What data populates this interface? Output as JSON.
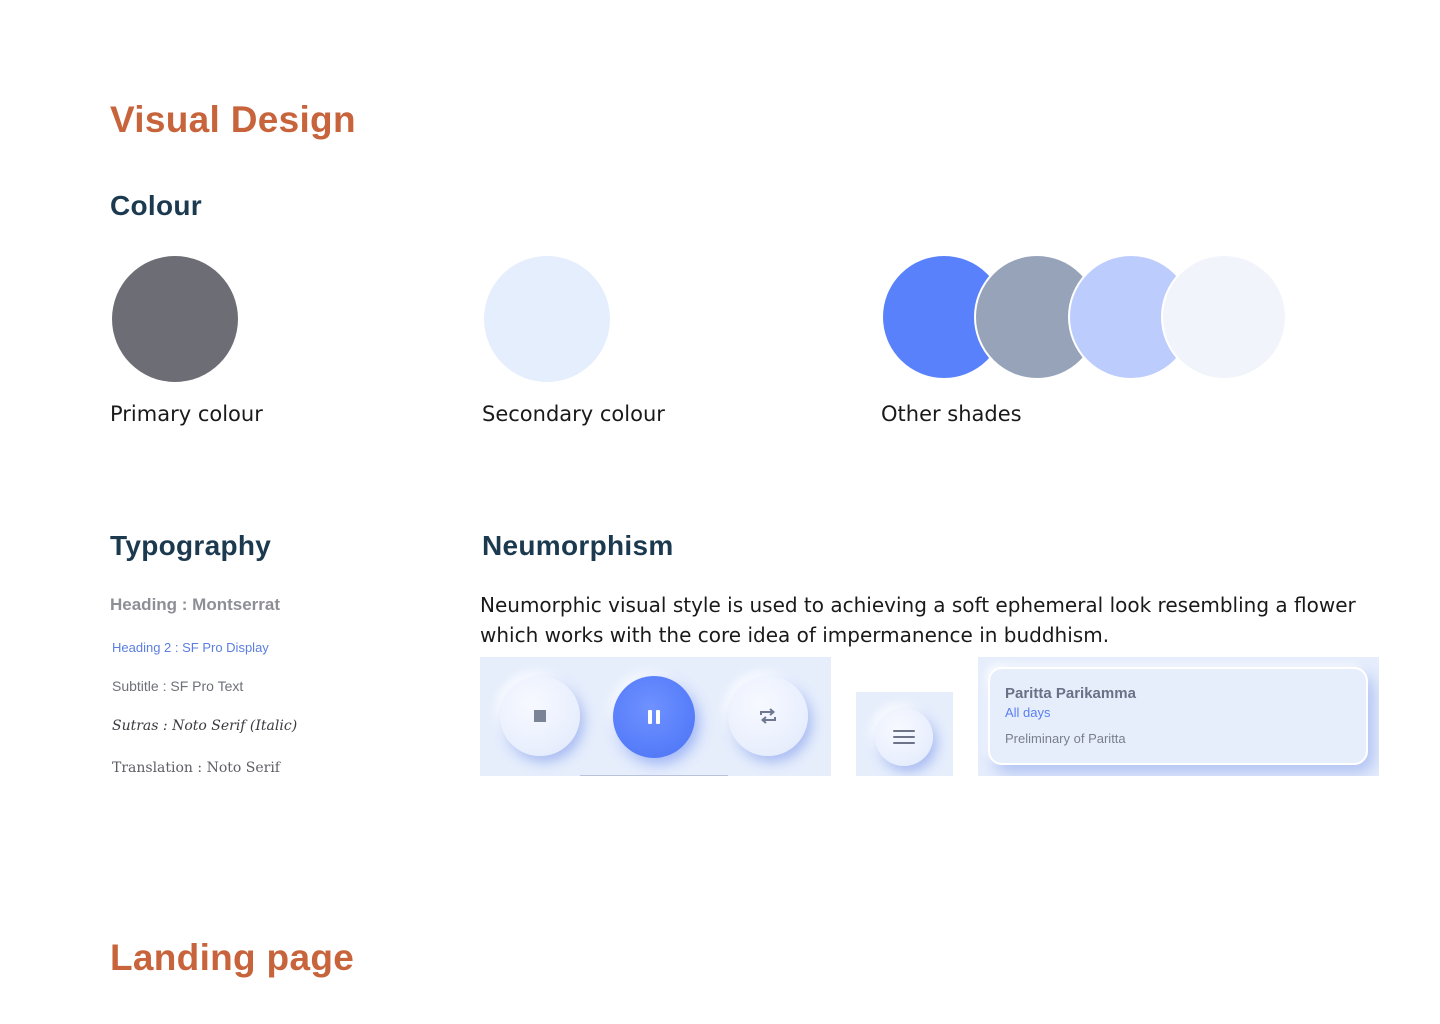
{
  "visual_design_title": "Visual Design",
  "colour": {
    "heading": "Colour",
    "primary": {
      "label": "Primary colour",
      "color": "#6D6D75"
    },
    "secondary": {
      "label": "Secondary colour",
      "color": "#E5EEFD"
    },
    "other": {
      "label": "Other shades",
      "colors": [
        "#5881FB",
        "#96A3B9",
        "#BCCCFD",
        "#F1F4FA"
      ]
    }
  },
  "typography": {
    "heading": "Typography",
    "items": [
      "Heading : Montserrat",
      "Heading 2 : SF Pro Display",
      "Subtitle : SF Pro Text",
      "Sutras : Noto Serif (Italic)",
      "Translation : Noto Serif"
    ]
  },
  "neumorphism": {
    "heading": "Neumorphism",
    "description": "Neumorphic visual style is used to achieving a soft ephemeral look resembling a flower which works with the core idea of impermanence in buddhism.",
    "player_icons": [
      "stop-icon",
      "pause-icon",
      "repeat-icon"
    ],
    "menu_icon": "menu-icon",
    "card": {
      "title": "Paritta Parikamma",
      "subtitle": "All days",
      "description": "Preliminary of Paritta"
    }
  },
  "landing_page_title": "Landing page"
}
